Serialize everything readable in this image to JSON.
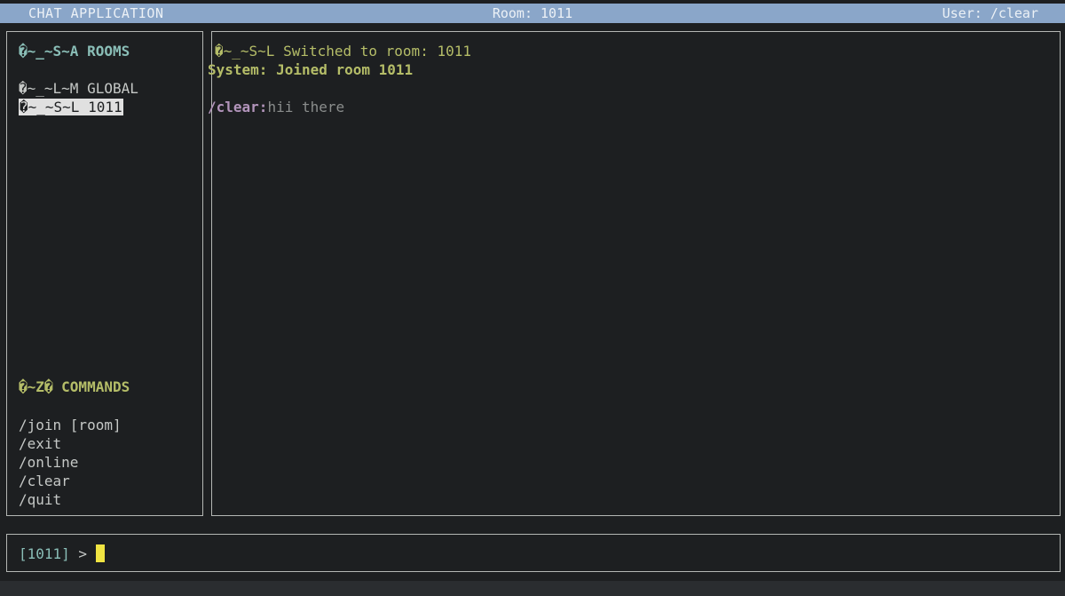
{
  "header": {
    "app_title": "CHAT APPLICATION",
    "room_label": "Room: 1011",
    "user_label": "User: /clear"
  },
  "sidebar": {
    "rooms_title": "�~_~S~A ROOMS",
    "rooms": [
      {
        "label": "�~_~L~M GLOBAL",
        "active": false
      },
      {
        "label": "�~_~S~L 1011",
        "active": true
      }
    ],
    "commands_title": "�~Z� COMMANDS",
    "commands": [
      "/join [room]",
      "/exit",
      "/online",
      "/clear",
      "/quit"
    ]
  },
  "chat": {
    "switched_line": "�~_~S~L Switched to room: 1011",
    "system_line": "System: Joined room 1011",
    "message": {
      "user": "/clear:",
      "text": "hii there"
    }
  },
  "input": {
    "prompt_room": "[1011]",
    "prompt_symbol": " >"
  },
  "colors": {
    "header_bg": "#8aa6c9",
    "background": "#1d1f21",
    "cursor": "#f0e442",
    "accent_cyan": "#8abeb7",
    "accent_green": "#b5bd68",
    "accent_purple": "#b294bb"
  }
}
